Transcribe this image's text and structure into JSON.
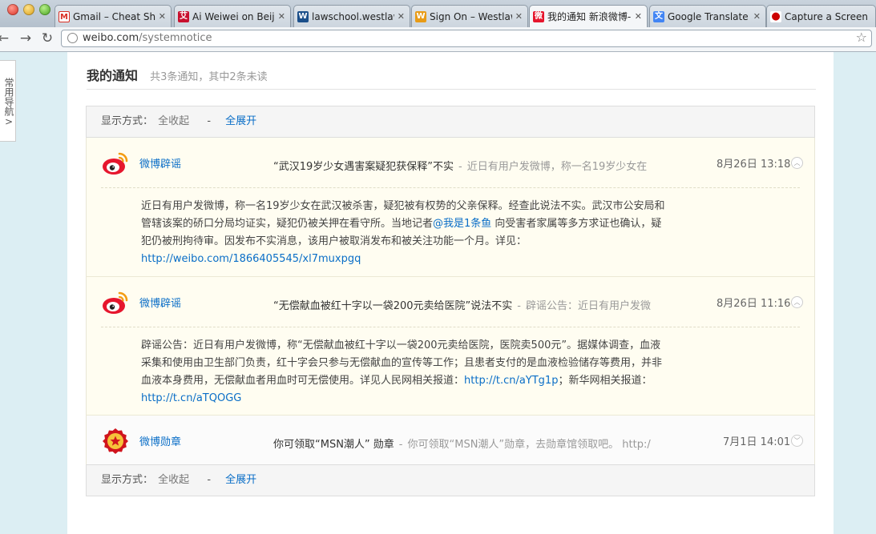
{
  "browser": {
    "tabs": [
      {
        "title": "Gmail – Cheat Shee",
        "favicon": "M",
        "color": "#d93025"
      },
      {
        "title": "Ai Weiwei on Beijin",
        "favicon": "艾",
        "color": "#c8102e"
      },
      {
        "title": "lawschool.westlaw.",
        "favicon": "W",
        "color": "#1b4f8a"
      },
      {
        "title": "Sign On – Westlaw",
        "favicon": "W",
        "color": "#e89b16"
      },
      {
        "title": "我的通知 新浪微博-随",
        "favicon": "微",
        "color": "#e6162d"
      },
      {
        "title": "Google Translate",
        "favicon": "文",
        "color": "#4285f4"
      },
      {
        "title": "Capture a Screen S",
        "favicon": "●",
        "color": "#cc0000"
      }
    ],
    "url_host": "weibo.com",
    "url_path": "/systemnotice"
  },
  "side_nav": {
    "label": "常用导航>"
  },
  "page": {
    "title": "我的通知",
    "subtitle": "共3条通知，其中2条未读"
  },
  "filter": {
    "label": "显示方式：",
    "collapse_all": "全收起",
    "separator": "-",
    "expand_all": "全展开"
  },
  "notices": [
    {
      "sender": "微博辟谣",
      "subject": "“武汉19岁少女遇害案疑犯获保释”不实",
      "dash": "-",
      "snippet": "近日有用户发微博，称一名19岁少女在",
      "time": "8月26日 13:18",
      "expanded": true,
      "body_before": "近日有用户发微博，称一名19岁少女在武汉被杀害，疑犯被有权势的父亲保释。经查此说法不实。武汉市公安局和管辖该案的硚口分局均证实，疑犯仍被关押在看守所。当地记者",
      "mention": "@我是1条鱼",
      "body_after": " 向受害者家属等多方求证也确认，疑犯仍被刑拘待审。因发布不实消息，该用户被取消发布和被关注功能一个月。详见：",
      "link": "http://weibo.com/1866405545/xl7muxpgq"
    },
    {
      "sender": "微博辟谣",
      "subject": "“无偿献血被红十字以一袋200元卖给医院”说法不实",
      "dash": "-",
      "snippet": "辟谣公告：近日有用户发微",
      "time": "8月26日 11:16",
      "expanded": true,
      "body_before": "辟谣公告：近日有用户发微博，称“无偿献血被红十字以一袋200元卖给医院，医院卖500元”。据媒体调查，血液采集和使用由卫生部门负责，红十字会只参与无偿献血的宣传等工作；且患者支付的是血液检验储存等费用，并非血液本身费用，无偿献血者用血时可无偿使用。详见人民网相关报道：",
      "link1": "http://t.cn/aYTg1p",
      "middle": "；新华网相关报道：",
      "link2": "http://t.cn/aTQOGG"
    },
    {
      "sender": "微博勋章",
      "subject": "你可领取“MSN潮人” 勋章",
      "dash": "-",
      "snippet": "你可领取“MSN潮人”勋章，去勋章馆领取吧。 http:/",
      "time": "7月1日 14:01",
      "expanded": false
    }
  ],
  "icons": {
    "notice_logo_1": "weibo-logo-icon",
    "notice_logo_2": "weibo-logo-icon",
    "notice_logo_3": "medal-icon",
    "toggle_open": "chevron-up-icon",
    "toggle_closed": "chevron-down-icon"
  },
  "colors": {
    "link": "#0a6ec7",
    "page_bg": "#dceef3",
    "expanded_bg": "#fffdf1"
  }
}
